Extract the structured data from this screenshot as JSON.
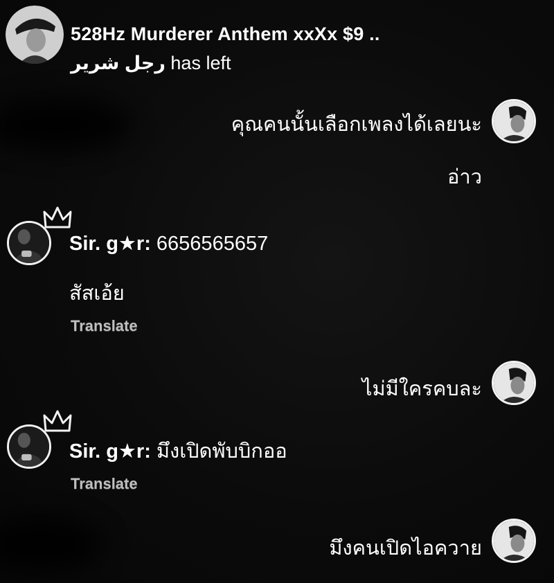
{
  "header": {
    "title": "528Hz Murderer Anthem xxXx $9 ..",
    "left_user": "رجل شرير",
    "left_suffix": "has left"
  },
  "messages": [
    {
      "side": "right",
      "text": "คุณคนนั้นเลือกเพลงได้เลยนะ"
    },
    {
      "side": "right",
      "text": "อ่าว"
    },
    {
      "side": "left",
      "user": "Sir. g★r:",
      "text": "6656565657"
    },
    {
      "side": "left",
      "text": "สัสเอ้ย"
    },
    {
      "side": "left",
      "action": "Translate"
    },
    {
      "side": "right",
      "text": "ไม่มีใครคบละ"
    },
    {
      "side": "left",
      "user": "Sir. g★r:",
      "text": "มึงเปิดพับบิกออ"
    },
    {
      "side": "left",
      "action": "Translate"
    },
    {
      "side": "right",
      "text": "มึงคนเปิดไอควาย"
    }
  ],
  "colors": {
    "background": "#0b0b0b",
    "text": "#ffffff",
    "translate": "#bfbfbf",
    "avatar_border": "#f2f2f2"
  },
  "icons": [
    "crown-icon"
  ]
}
